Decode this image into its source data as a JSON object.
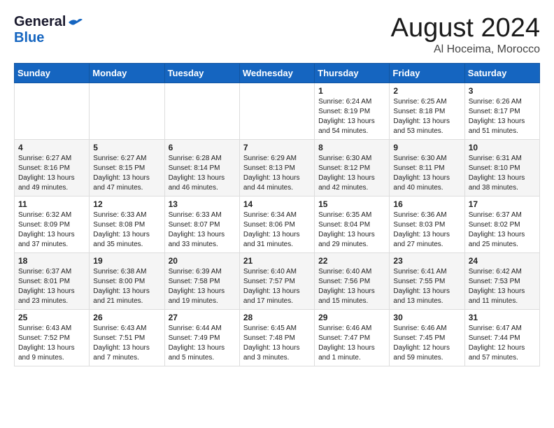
{
  "header": {
    "logo_general": "General",
    "logo_blue": "Blue",
    "month": "August 2024",
    "location": "Al Hoceima, Morocco"
  },
  "weekdays": [
    "Sunday",
    "Monday",
    "Tuesday",
    "Wednesday",
    "Thursday",
    "Friday",
    "Saturday"
  ],
  "rows": [
    [
      {
        "day": "",
        "content": ""
      },
      {
        "day": "",
        "content": ""
      },
      {
        "day": "",
        "content": ""
      },
      {
        "day": "",
        "content": ""
      },
      {
        "day": "1",
        "content": "Sunrise: 6:24 AM\nSunset: 8:19 PM\nDaylight: 13 hours\nand 54 minutes."
      },
      {
        "day": "2",
        "content": "Sunrise: 6:25 AM\nSunset: 8:18 PM\nDaylight: 13 hours\nand 53 minutes."
      },
      {
        "day": "3",
        "content": "Sunrise: 6:26 AM\nSunset: 8:17 PM\nDaylight: 13 hours\nand 51 minutes."
      }
    ],
    [
      {
        "day": "4",
        "content": "Sunrise: 6:27 AM\nSunset: 8:16 PM\nDaylight: 13 hours\nand 49 minutes."
      },
      {
        "day": "5",
        "content": "Sunrise: 6:27 AM\nSunset: 8:15 PM\nDaylight: 13 hours\nand 47 minutes."
      },
      {
        "day": "6",
        "content": "Sunrise: 6:28 AM\nSunset: 8:14 PM\nDaylight: 13 hours\nand 46 minutes."
      },
      {
        "day": "7",
        "content": "Sunrise: 6:29 AM\nSunset: 8:13 PM\nDaylight: 13 hours\nand 44 minutes."
      },
      {
        "day": "8",
        "content": "Sunrise: 6:30 AM\nSunset: 8:12 PM\nDaylight: 13 hours\nand 42 minutes."
      },
      {
        "day": "9",
        "content": "Sunrise: 6:30 AM\nSunset: 8:11 PM\nDaylight: 13 hours\nand 40 minutes."
      },
      {
        "day": "10",
        "content": "Sunrise: 6:31 AM\nSunset: 8:10 PM\nDaylight: 13 hours\nand 38 minutes."
      }
    ],
    [
      {
        "day": "11",
        "content": "Sunrise: 6:32 AM\nSunset: 8:09 PM\nDaylight: 13 hours\nand 37 minutes."
      },
      {
        "day": "12",
        "content": "Sunrise: 6:33 AM\nSunset: 8:08 PM\nDaylight: 13 hours\nand 35 minutes."
      },
      {
        "day": "13",
        "content": "Sunrise: 6:33 AM\nSunset: 8:07 PM\nDaylight: 13 hours\nand 33 minutes."
      },
      {
        "day": "14",
        "content": "Sunrise: 6:34 AM\nSunset: 8:06 PM\nDaylight: 13 hours\nand 31 minutes."
      },
      {
        "day": "15",
        "content": "Sunrise: 6:35 AM\nSunset: 8:04 PM\nDaylight: 13 hours\nand 29 minutes."
      },
      {
        "day": "16",
        "content": "Sunrise: 6:36 AM\nSunset: 8:03 PM\nDaylight: 13 hours\nand 27 minutes."
      },
      {
        "day": "17",
        "content": "Sunrise: 6:37 AM\nSunset: 8:02 PM\nDaylight: 13 hours\nand 25 minutes."
      }
    ],
    [
      {
        "day": "18",
        "content": "Sunrise: 6:37 AM\nSunset: 8:01 PM\nDaylight: 13 hours\nand 23 minutes."
      },
      {
        "day": "19",
        "content": "Sunrise: 6:38 AM\nSunset: 8:00 PM\nDaylight: 13 hours\nand 21 minutes."
      },
      {
        "day": "20",
        "content": "Sunrise: 6:39 AM\nSunset: 7:58 PM\nDaylight: 13 hours\nand 19 minutes."
      },
      {
        "day": "21",
        "content": "Sunrise: 6:40 AM\nSunset: 7:57 PM\nDaylight: 13 hours\nand 17 minutes."
      },
      {
        "day": "22",
        "content": "Sunrise: 6:40 AM\nSunset: 7:56 PM\nDaylight: 13 hours\nand 15 minutes."
      },
      {
        "day": "23",
        "content": "Sunrise: 6:41 AM\nSunset: 7:55 PM\nDaylight: 13 hours\nand 13 minutes."
      },
      {
        "day": "24",
        "content": "Sunrise: 6:42 AM\nSunset: 7:53 PM\nDaylight: 13 hours\nand 11 minutes."
      }
    ],
    [
      {
        "day": "25",
        "content": "Sunrise: 6:43 AM\nSunset: 7:52 PM\nDaylight: 13 hours\nand 9 minutes."
      },
      {
        "day": "26",
        "content": "Sunrise: 6:43 AM\nSunset: 7:51 PM\nDaylight: 13 hours\nand 7 minutes."
      },
      {
        "day": "27",
        "content": "Sunrise: 6:44 AM\nSunset: 7:49 PM\nDaylight: 13 hours\nand 5 minutes."
      },
      {
        "day": "28",
        "content": "Sunrise: 6:45 AM\nSunset: 7:48 PM\nDaylight: 13 hours\nand 3 minutes."
      },
      {
        "day": "29",
        "content": "Sunrise: 6:46 AM\nSunset: 7:47 PM\nDaylight: 13 hours\nand 1 minute."
      },
      {
        "day": "30",
        "content": "Sunrise: 6:46 AM\nSunset: 7:45 PM\nDaylight: 12 hours\nand 59 minutes."
      },
      {
        "day": "31",
        "content": "Sunrise: 6:47 AM\nSunset: 7:44 PM\nDaylight: 12 hours\nand 57 minutes."
      }
    ]
  ]
}
